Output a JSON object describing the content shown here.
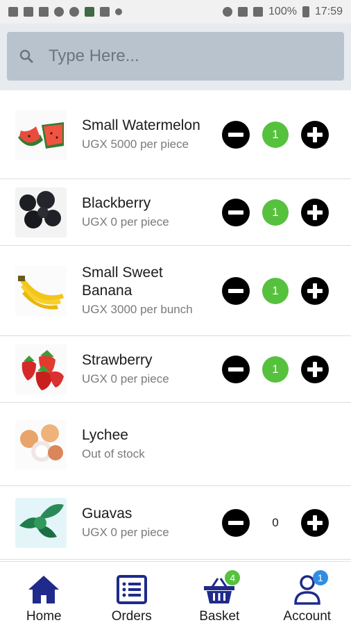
{
  "status_bar": {
    "battery": "100%",
    "time": "17:59",
    "left_icons": [
      "image-icon",
      "mail-icon",
      "calendar-icon",
      "face-icon",
      "face-icon",
      "app-icon",
      "weather-icon",
      "dots-icon"
    ],
    "right_icons": [
      "alarm-icon",
      "wifi-icon",
      "signal-icon",
      "battery-icon"
    ]
  },
  "search": {
    "placeholder": "Type Here..."
  },
  "products": [
    {
      "name": "Small Watermelon",
      "price": "UGX 5000 per piece",
      "quantity": "1",
      "in_stock": true,
      "image": "watermelon"
    },
    {
      "name": "Blackberry",
      "price": "UGX 0 per piece",
      "quantity": "1",
      "in_stock": true,
      "image": "blackberry"
    },
    {
      "name": "Small Sweet Banana",
      "price": "UGX 3000 per bunch",
      "quantity": "1",
      "in_stock": true,
      "image": "banana"
    },
    {
      "name": "Strawberry",
      "price": "UGX 0 per piece",
      "quantity": "1",
      "in_stock": true,
      "image": "strawberry"
    },
    {
      "name": "Lychee",
      "price": "Out of stock",
      "quantity": "",
      "in_stock": false,
      "image": "lychee"
    },
    {
      "name": "Guavas",
      "price": "UGX 0 per piece",
      "quantity": "0",
      "in_stock": true,
      "image": "guava"
    }
  ],
  "nav": {
    "items": [
      {
        "label": "Home",
        "icon": "home-icon",
        "badge": ""
      },
      {
        "label": "Orders",
        "icon": "list-icon",
        "badge": ""
      },
      {
        "label": "Basket",
        "icon": "basket-icon",
        "badge": "4"
      },
      {
        "label": "Account",
        "icon": "user-icon",
        "badge": "1"
      }
    ]
  },
  "colors": {
    "accent_green": "#56c13d",
    "nav_icon": "#1f2a8a",
    "badge_green": "#56c13d",
    "badge_blue": "#2f8ee3",
    "search_bg": "#b9c3cd"
  }
}
